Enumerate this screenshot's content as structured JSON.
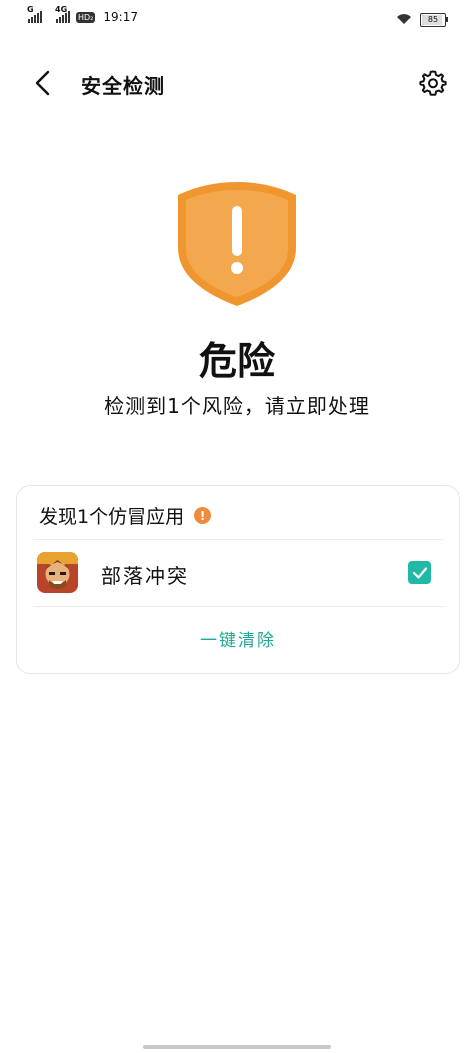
{
  "status_bar": {
    "network1": "G",
    "network2": "4G",
    "hd_badge": "HD₂",
    "time": "19:17",
    "battery": "85"
  },
  "header": {
    "title": "安全检测",
    "icons": {
      "back": "back-arrow-icon",
      "settings": "gear-icon"
    }
  },
  "status": {
    "title": "危险",
    "subtitle": "检测到1个风险，请立即处理",
    "shield_color": "#f0962e",
    "shield_inner_color": "#f4a84e"
  },
  "card": {
    "heading": "发现1个仿冒应用",
    "warning_mark": "!",
    "apps": [
      {
        "name": "部落冲突",
        "checked": true
      }
    ],
    "action_label": "一键清除",
    "accent_color": "#22b8a6"
  }
}
